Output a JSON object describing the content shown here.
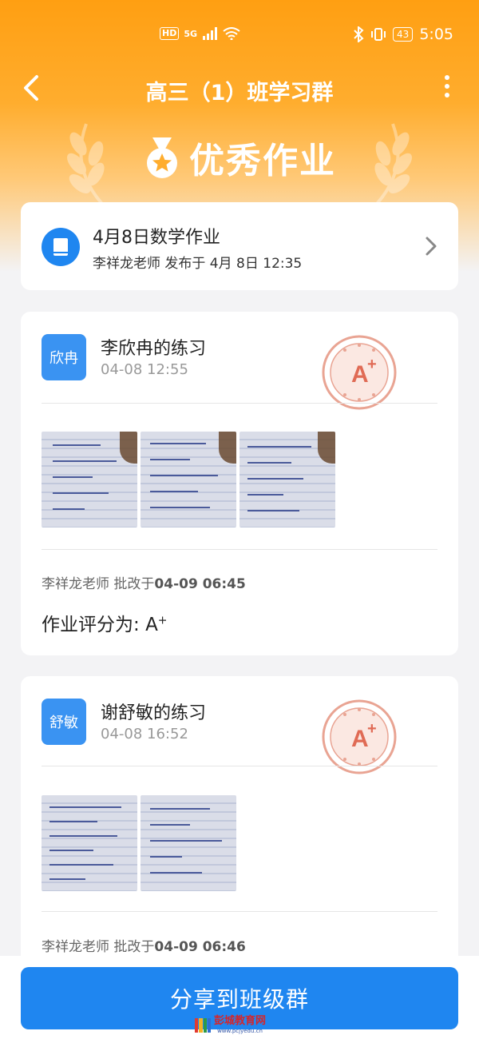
{
  "status_bar": {
    "left_badges": [
      "HD",
      "5G"
    ],
    "battery": "43",
    "time": "5:05"
  },
  "header": {
    "title": "高三（1）班学习群"
  },
  "banner": {
    "title": "优秀作业"
  },
  "homework": {
    "title": "4月8日数学作业",
    "subtitle": "李祥龙老师 发布于 4月 8日 12:35"
  },
  "submissions": [
    {
      "avatar": "欣冉",
      "name": "李欣冉的练习",
      "time": "04-08 12:55",
      "photo_count": 3,
      "grader_prefix": "李祥龙老师 批改于",
      "grader_time": "04-09 06:45",
      "score_label": "作业评分为:",
      "score_grade": "A",
      "score_mark": "+"
    },
    {
      "avatar": "舒敏",
      "name": "谢舒敏的练习",
      "time": "04-08 16:52",
      "photo_count": 2,
      "grader_prefix": "李祥龙老师 批改于",
      "grader_time": "04-09 06:46"
    }
  ],
  "footer": {
    "share_label": "分享到班级群"
  },
  "watermark": {
    "name": "彭城教育网",
    "url": "www.pcjyedu.cn"
  },
  "colors": {
    "header_orange": "#ff9f12",
    "accent_blue": "#1f86f0",
    "stamp_red": "#e06b55"
  }
}
